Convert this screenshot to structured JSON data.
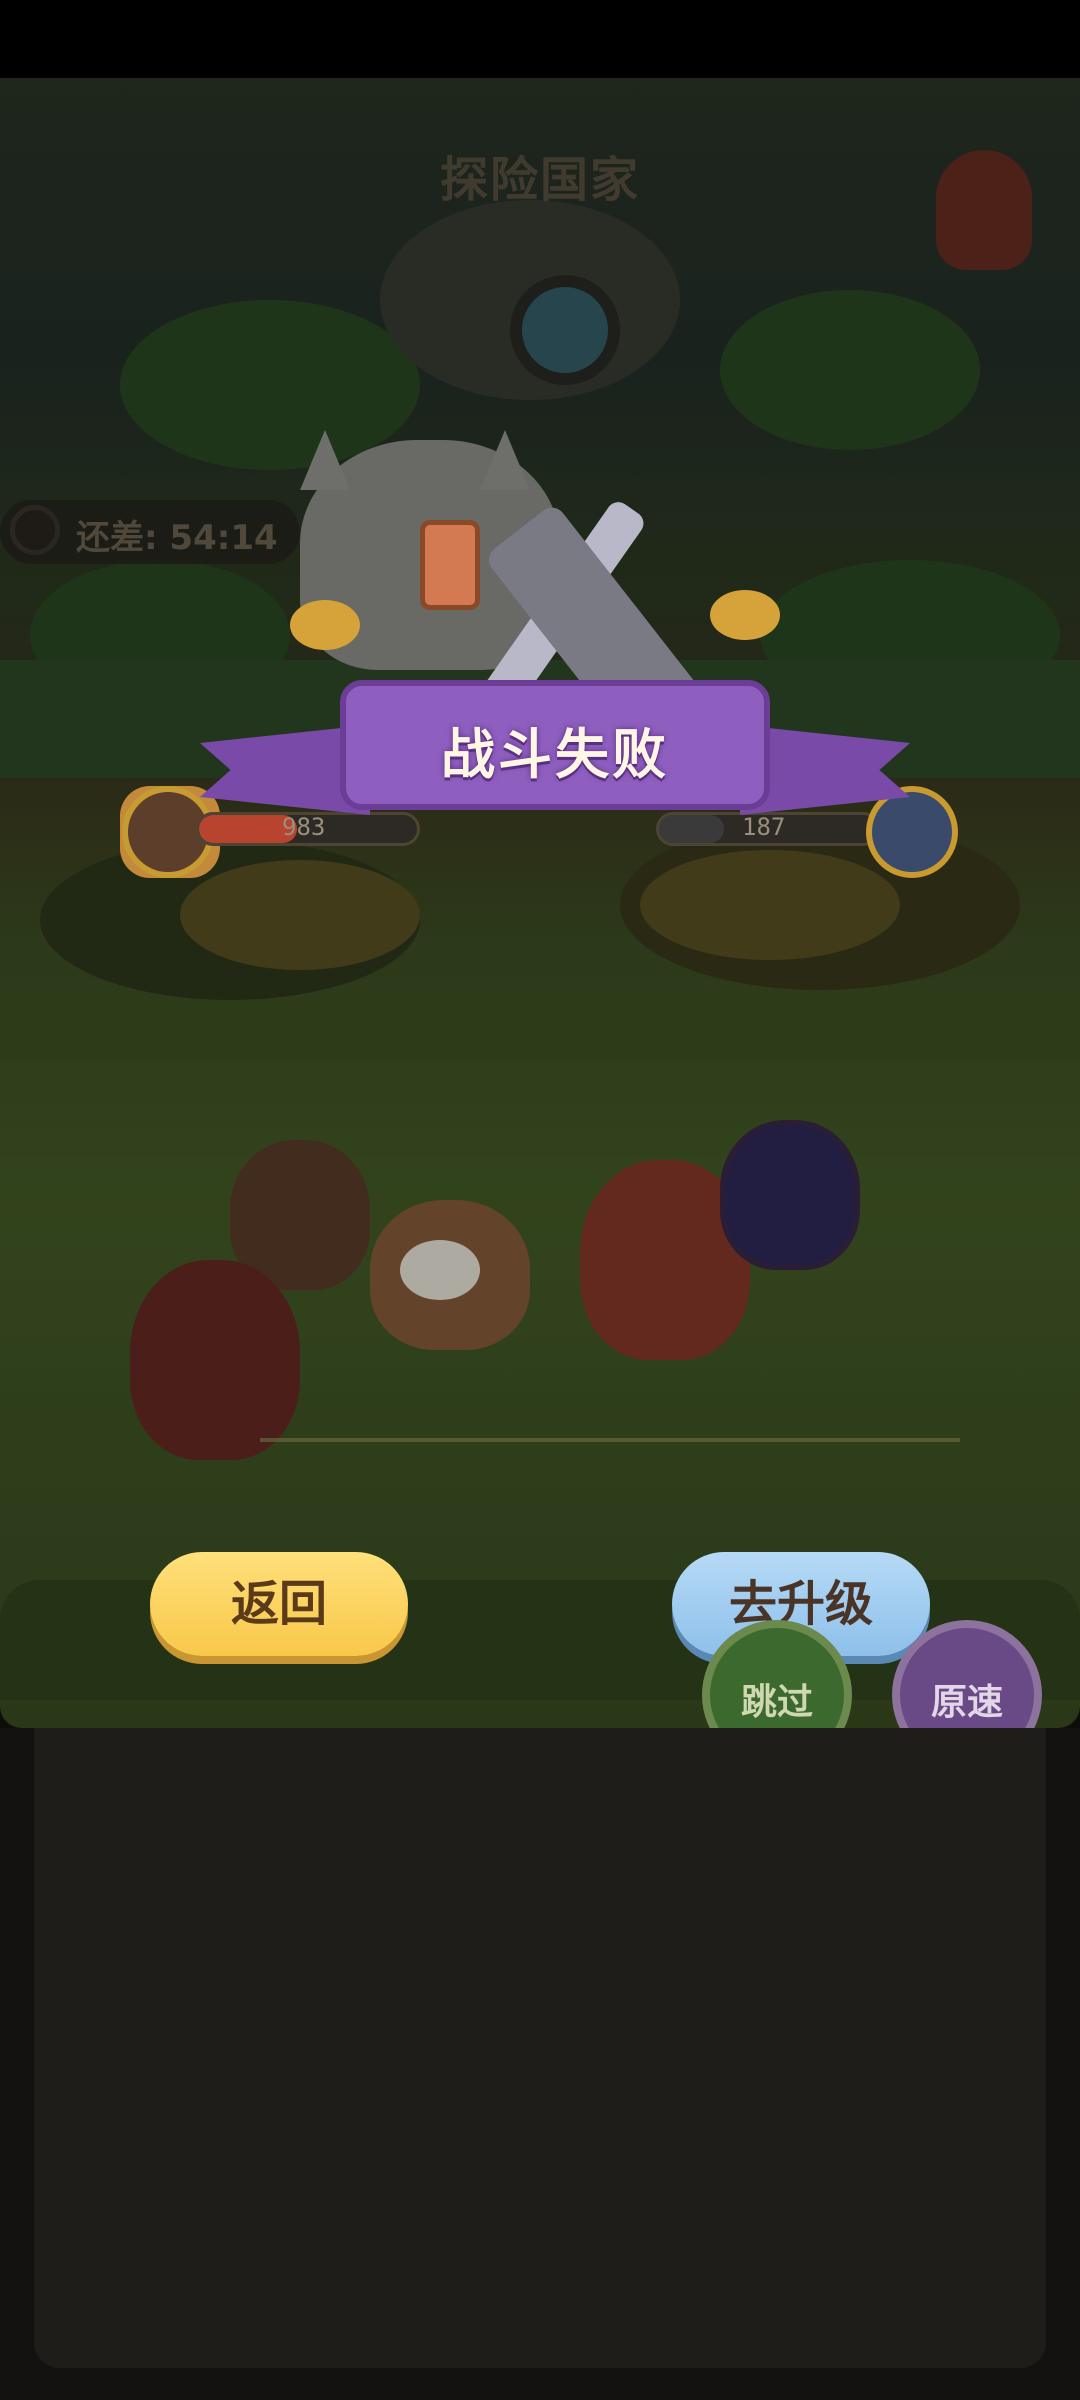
{
  "header": {
    "title": "探险国家"
  },
  "timer": {
    "text": "还差: 54:14"
  },
  "player": {
    "hp": 983,
    "hp_fraction": 0.45
  },
  "enemy": {
    "hp": 187,
    "hp_fraction": 0.3
  },
  "result": {
    "banner_text": "战斗失败"
  },
  "buttons": {
    "return_label": "返回",
    "upgrade_label": "去升级",
    "skip_label": "跳过",
    "speed_label": "原速"
  },
  "colors": {
    "banner": "#8e5fbf",
    "return_button": "#f8c84a",
    "upgrade_button": "#8ec0ea",
    "skip_button": "#3c6a2e",
    "speed_button": "#6a4a86",
    "player_hp": "#b8432f",
    "enemy_hp": "#3a3a3a"
  },
  "icons": [
    "clock-icon",
    "player-avatar",
    "enemy-avatar",
    "crossed-swords-icon",
    "hammer-icon",
    "trumpet-icon",
    "lantern-icon"
  ]
}
